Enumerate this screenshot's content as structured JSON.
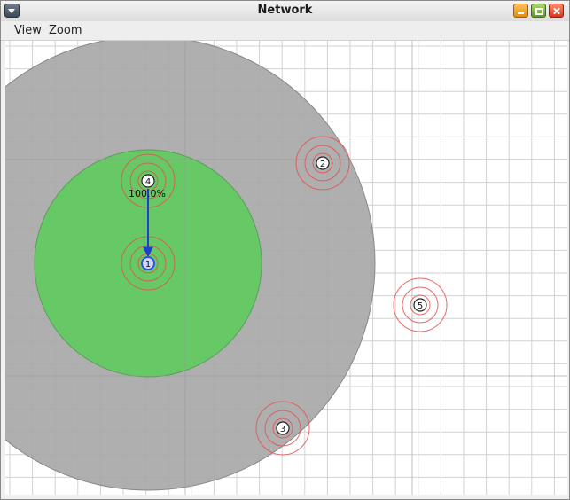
{
  "window": {
    "title": "Network"
  },
  "menu": {
    "items": [
      "View",
      "Zoom"
    ]
  },
  "colors": {
    "range_outer": "#a8a8a8",
    "range_inner": "#66c966",
    "link": "#1f3fd0",
    "ring": "#e55050",
    "grid_minor": "#d2d2d2",
    "grid_major": "#9a9a9a"
  },
  "nodes": [
    {
      "id": "1",
      "selected": true
    },
    {
      "id": "2"
    },
    {
      "id": "3"
    },
    {
      "id": "4"
    },
    {
      "id": "5"
    }
  ],
  "link_label": "100.0%"
}
